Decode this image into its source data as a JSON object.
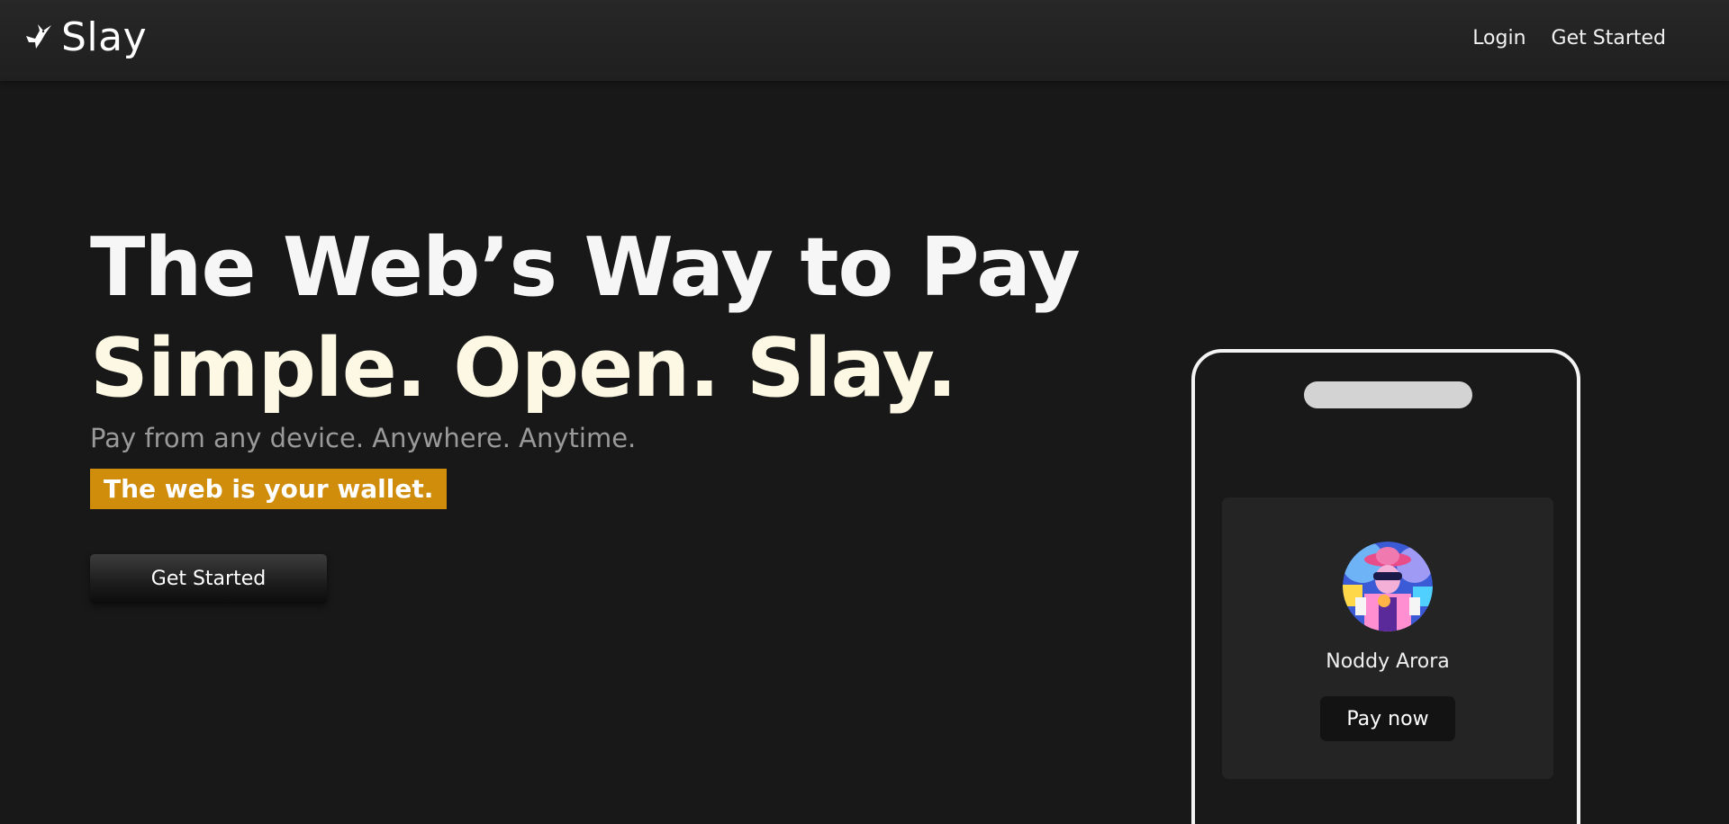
{
  "navbar": {
    "brand": {
      "name": "Slay",
      "icon": "bird-icon"
    },
    "links": [
      {
        "label": "Login"
      },
      {
        "label": "Get Started"
      }
    ]
  },
  "hero": {
    "title": "The Web’s Way to Pay",
    "tagline": "Simple. Open. Slay.",
    "subtitle": "Pay from any device. Anywhere. Anytime.",
    "highlight": "The web is your wallet.",
    "cta_label": "Get Started"
  },
  "phone_mockup": {
    "payee_name": "Noddy Arora",
    "pay_button_label": "Pay now",
    "avatar": "payee-avatar"
  },
  "colors": {
    "background": "#181818",
    "navbar": "#242424",
    "highlight": "#d08d0c",
    "tagline": "#fcf8e3",
    "subtitle": "#9a9a9a",
    "phone_frame": "#f4f4f4",
    "card": "#242424"
  }
}
